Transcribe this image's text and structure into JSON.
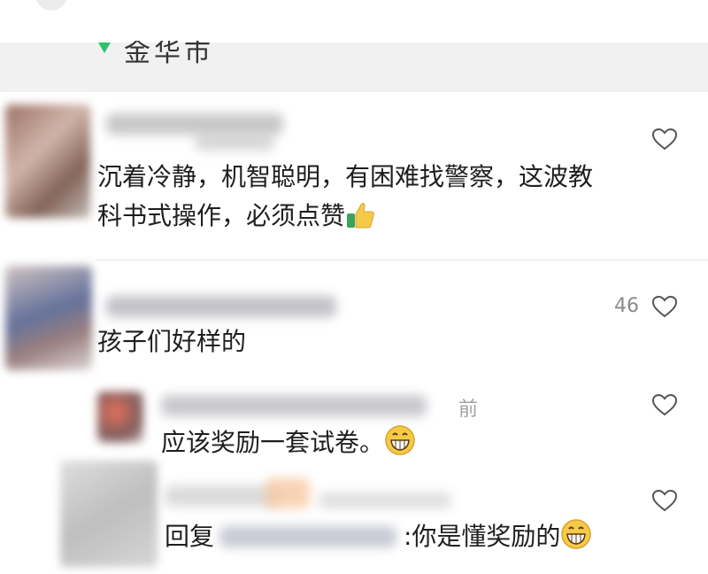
{
  "location": {
    "text": "金华市",
    "pin_color": "#2fc26a"
  },
  "comments": [
    {
      "text_line1": "沉着冷静，机智聪明，有困难找警察，这波教",
      "text_line2": "科书式操作，必须点赞",
      "emoji": "thumbs-up-icon",
      "likes": ""
    },
    {
      "text": "孩子们好样的",
      "likes": "46"
    }
  ],
  "replies": [
    {
      "time": "前",
      "text": "应该奖励一套试卷。",
      "emoji": "grin-icon"
    },
    {
      "prefix": "回复",
      "text": ":你是懂奖励的",
      "emoji": "grin-icon"
    }
  ],
  "colors": {
    "heart_stroke": "#555555",
    "emoji_yellow": "#f7c948"
  }
}
